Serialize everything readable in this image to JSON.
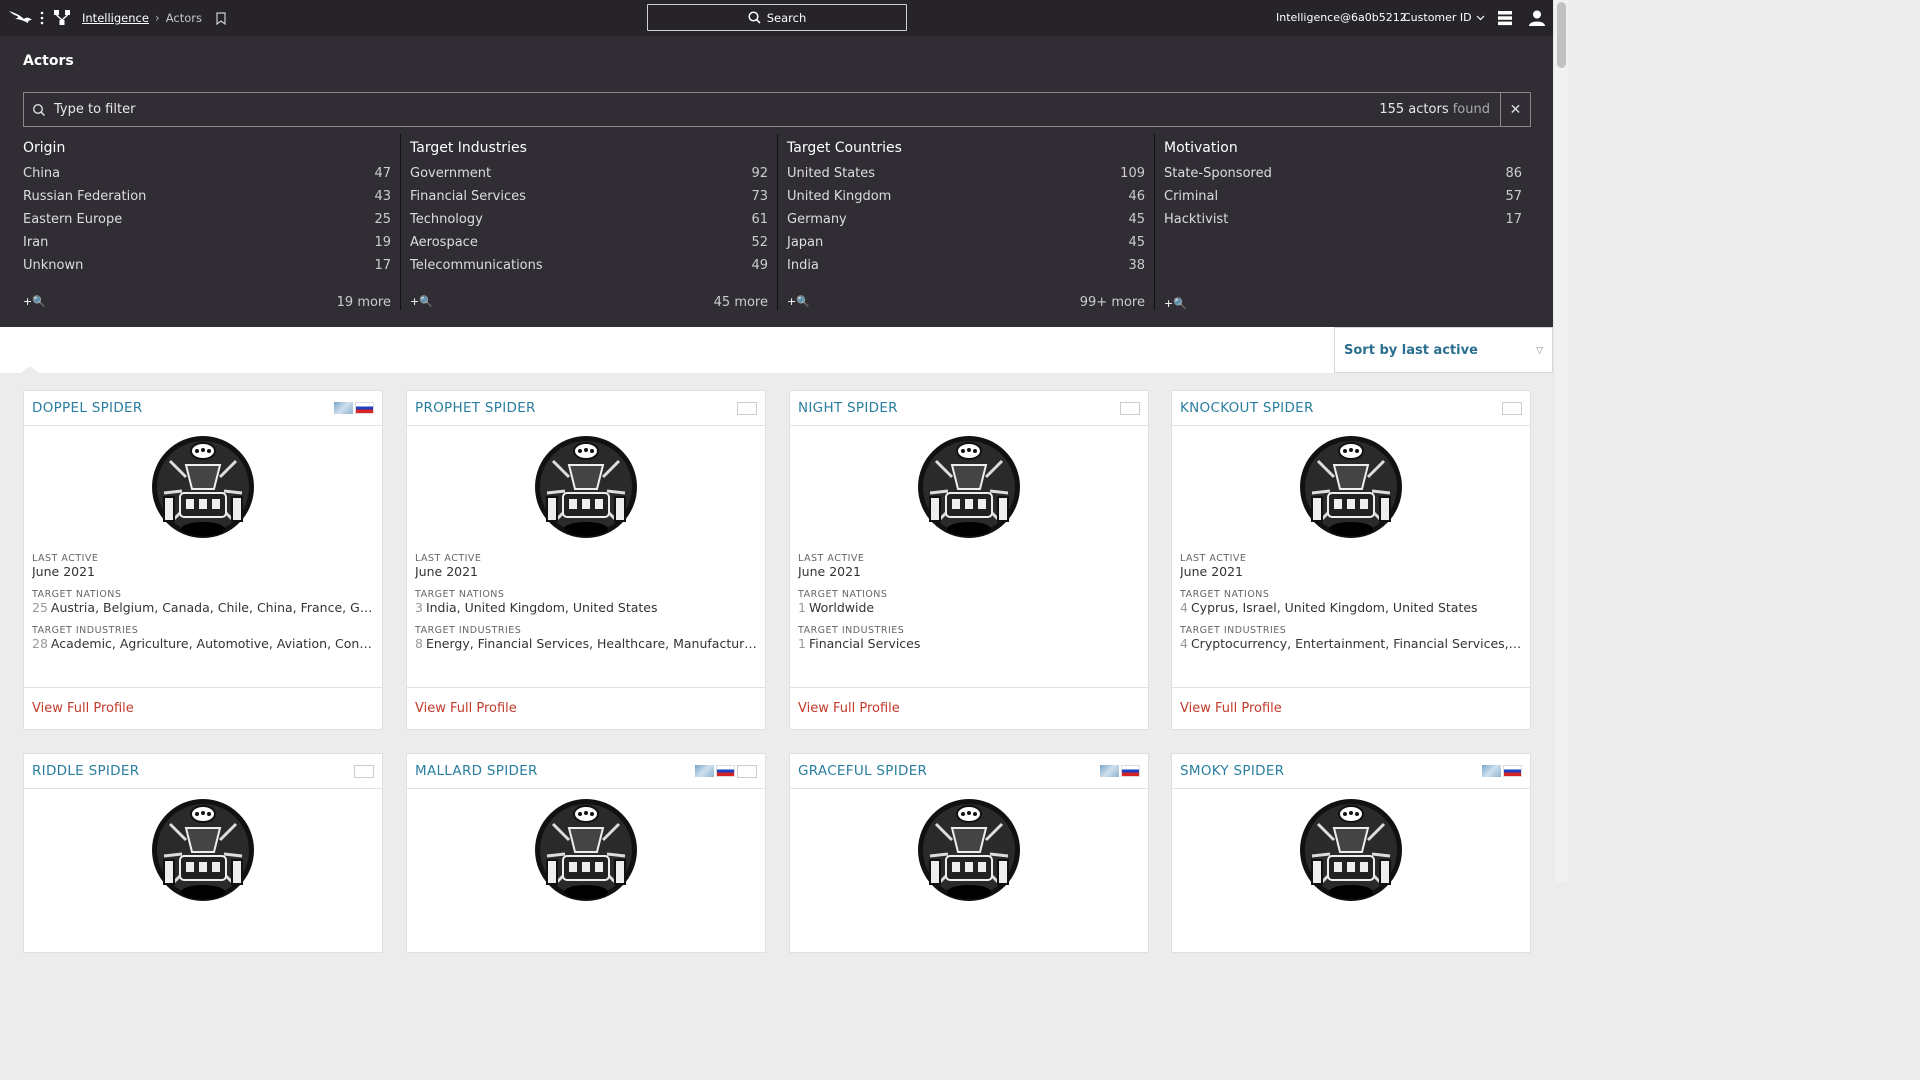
{
  "topbar": {
    "app_link": "Intelligence",
    "breadcrumb_current": "Actors",
    "search_label": "Search",
    "user": "Intelligence@6a0b5212",
    "customer_label": "Customer ID"
  },
  "panel": {
    "title": "Actors",
    "filter_placeholder": "Type to filter",
    "found_count": "155 actors",
    "found_word": "found",
    "clear": "✕"
  },
  "facets": [
    {
      "title": "Origin",
      "rows": [
        {
          "label": "China",
          "count": "47"
        },
        {
          "label": "Russian Federation",
          "count": "43"
        },
        {
          "label": "Eastern Europe",
          "count": "25"
        },
        {
          "label": "Iran",
          "count": "19"
        },
        {
          "label": "Unknown",
          "count": "17"
        }
      ],
      "more": "19 more"
    },
    {
      "title": "Target Industries",
      "rows": [
        {
          "label": "Government",
          "count": "92"
        },
        {
          "label": "Financial Services",
          "count": "73"
        },
        {
          "label": "Technology",
          "count": "61"
        },
        {
          "label": "Aerospace",
          "count": "52"
        },
        {
          "label": "Telecommunications",
          "count": "49"
        }
      ],
      "more": "45 more"
    },
    {
      "title": "Target Countries",
      "rows": [
        {
          "label": "United States",
          "count": "109"
        },
        {
          "label": "United Kingdom",
          "count": "46"
        },
        {
          "label": "Germany",
          "count": "45"
        },
        {
          "label": "Japan",
          "count": "45"
        },
        {
          "label": "India",
          "count": "38"
        }
      ],
      "more": "99+ more"
    },
    {
      "title": "Motivation",
      "rows": [
        {
          "label": "State-Sponsored",
          "count": "86"
        },
        {
          "label": "Criminal",
          "count": "57"
        },
        {
          "label": "Hacktivist",
          "count": "17"
        }
      ],
      "more": ""
    }
  ],
  "add_search_label": "+🔍",
  "sort": {
    "label": "Sort by last active"
  },
  "labels": {
    "last_active": "LAST ACTIVE",
    "target_nations": "TARGET NATIONS",
    "target_industries": "TARGET INDUSTRIES",
    "view_profile": "View Full Profile"
  },
  "cards": [
    {
      "name": "DOPPEL SPIDER",
      "flags": [
        "cs",
        "ru"
      ],
      "last_active": "June 2021",
      "nations_n": "25",
      "nations": "Austria, Belgium, Canada, Chile, China, France, Germany, Italy",
      "industries_n": "28",
      "industries": "Academic, Agriculture, Automotive, Aviation, Construction"
    },
    {
      "name": "PROPHET SPIDER",
      "flags": [
        "box"
      ],
      "last_active": "June 2021",
      "nations_n": "3",
      "nations": "India, United Kingdom, United States",
      "industries_n": "8",
      "industries": "Energy, Financial Services, Healthcare, Manufacturing"
    },
    {
      "name": "NIGHT SPIDER",
      "flags": [
        "box"
      ],
      "last_active": "June 2021",
      "nations_n": "1",
      "nations": "Worldwide",
      "industries_n": "1",
      "industries": "Financial Services"
    },
    {
      "name": "KNOCKOUT SPIDER",
      "flags": [
        "box"
      ],
      "last_active": "June 2021",
      "nations_n": "4",
      "nations": "Cyprus, Israel, United Kingdom, United States",
      "industries_n": "4",
      "industries": "Cryptocurrency, Entertainment, Financial Services, Gaming"
    },
    {
      "name": "RIDDLE SPIDER",
      "flags": [
        "box"
      ]
    },
    {
      "name": "MALLARD SPIDER",
      "flags": [
        "cs",
        "ru",
        "box"
      ]
    },
    {
      "name": "GRACEFUL SPIDER",
      "flags": [
        "cs",
        "ru"
      ]
    },
    {
      "name": "SMOKY SPIDER",
      "flags": [
        "cs",
        "ru"
      ]
    }
  ]
}
